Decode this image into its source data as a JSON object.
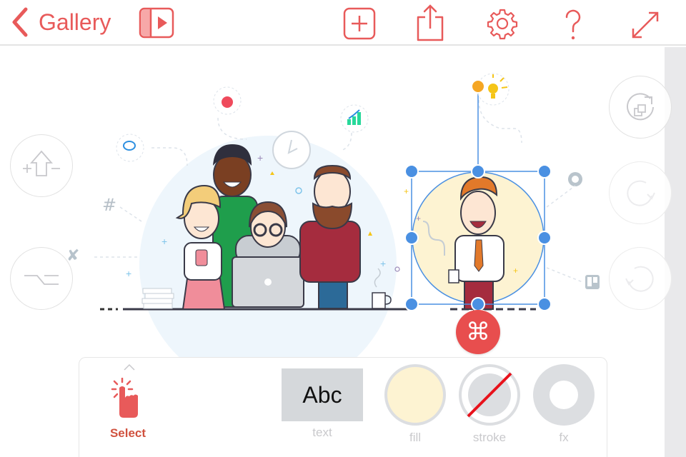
{
  "topbar": {
    "back_label": "Gallery",
    "icons": {
      "slideshow": "slideshow-play-icon",
      "add": "add-square-icon",
      "share": "share-icon",
      "settings": "gear-icon",
      "help": "question-icon",
      "fullscreen": "expand-icon"
    },
    "accent_color": "#e85a5a"
  },
  "left_tools": [
    {
      "name": "stroke-width-icon"
    },
    {
      "name": "path-smooth-icon"
    }
  ],
  "right_tools": [
    {
      "name": "rotate-duplicate-icon"
    },
    {
      "name": "redo-icon"
    },
    {
      "name": "undo-icon"
    }
  ],
  "canvas": {
    "selection_color": "#4a90e2",
    "command_button_glyph": "⌘",
    "selected_fill": "#fdf3d2"
  },
  "bottom_panel": {
    "select_label": "Select",
    "text_swatch": "Abc",
    "text_label": "text",
    "fill_label": "fill",
    "stroke_label": "stroke",
    "fx_label": "fx",
    "fill_color": "#fdf3d2",
    "stroke_none": true
  }
}
